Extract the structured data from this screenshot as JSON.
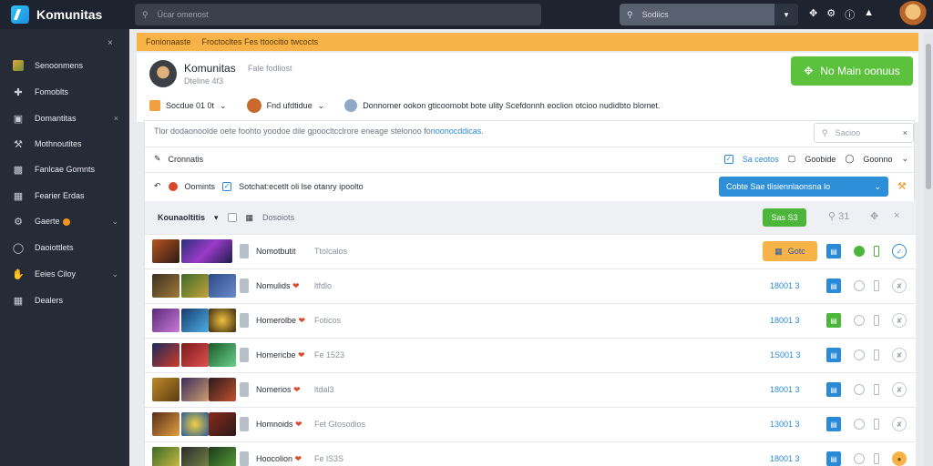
{
  "app": {
    "title": "Komunitas"
  },
  "topbar": {
    "search_placeholder": "Ücar omenost",
    "search2_value": "Sodiics",
    "search2_dropdown": "▾",
    "icons": [
      "puzzle-icon",
      "gear-icon",
      "info-icon",
      "bell-icon"
    ]
  },
  "sidebar": {
    "close": "×",
    "items": [
      {
        "label": "Senoonmens",
        "icon": "image-icon",
        "arrow": ""
      },
      {
        "label": "Fomoblts",
        "icon": "pin-icon",
        "arrow": ""
      },
      {
        "label": "Domantitas",
        "icon": "monitor-icon",
        "arrow": "×"
      },
      {
        "label": "Mothnoutites",
        "icon": "wrench-icon",
        "arrow": ""
      },
      {
        "label": "Fanlcae Gomnts",
        "icon": "screen-icon",
        "arrow": ""
      },
      {
        "label": "Fearier Erdas",
        "icon": "building-icon",
        "arrow": ""
      },
      {
        "label": "Gaerte",
        "icon": "gear-icon",
        "arrow": "⌄",
        "badge": true
      },
      {
        "label": "Daoiottlets",
        "icon": "circle-icon",
        "arrow": ""
      },
      {
        "label": "Eeies Ciloy",
        "icon": "thumb-icon",
        "arrow": "⌄"
      },
      {
        "label": "Dealers",
        "icon": "grid-icon",
        "arrow": ""
      }
    ]
  },
  "alert": {
    "left": "Fonionaaste",
    "text": "Froctocltes Fes  ttoocitio twcocts"
  },
  "profile": {
    "name": "Komunitas",
    "sub": "Fale fodliost",
    "role": "Dteline 4f3",
    "action_button": "No Main oonuus",
    "meta": [
      {
        "label": "Socdue 01 0t",
        "chevron": "⌄"
      },
      {
        "label": "Fnd ufdtidue",
        "chevron": "⌄"
      },
      {
        "label": "Donnomer ookon gticoomobt bote ulity Scefdonnh eoclion otcioo nudidbto blomet."
      }
    ]
  },
  "panel": {
    "notice_text": "Tlor dodaonoolde oete foohto yoodoe dile gpoocltcclrore eneage stelonoo fo",
    "notice_link": "noonocddicas.",
    "search_placeholder": "Sacioo",
    "row1": {
      "label": "Cronnatis",
      "opt1": "Sa ceotos",
      "opt2": "Goobide",
      "opt3": "Goonno",
      "chevron": "⌄"
    },
    "row2": {
      "label": "Oomints",
      "check_label": "Sotchat:ecetlt oli lse otanry ipoolto",
      "button": "Cobte Sae tlisiennlaonsna lo",
      "chevron": "⌄"
    },
    "thead": {
      "label": "Kounaoltitis",
      "chevron": "▾",
      "col2": "Dosoiots",
      "green_btn": "Sas S3",
      "icons": [
        "lock-count-icon",
        "puzzle-icon",
        "close-icon"
      ],
      "count": "31"
    }
  },
  "rows": [
    {
      "name": "Nomotbutit",
      "heart": false,
      "tag": "Ttolcalos",
      "num": "",
      "pill": "Gotc",
      "doc": "blue",
      "s1": "ok",
      "s2": "ok",
      "s3": "blue"
    },
    {
      "name": "Nomulids",
      "heart": true,
      "tag": "ltfdlo",
      "num": "18001 3",
      "pill": "",
      "doc": "blue",
      "s1": "",
      "s2": "",
      "s3": ""
    },
    {
      "name": "Homerolbe",
      "heart": true,
      "tag": "Foticos",
      "num": "18001 3",
      "pill": "",
      "doc": "green",
      "s1": "",
      "s2": "",
      "s3": ""
    },
    {
      "name": "Homericbe",
      "heart": true,
      "tag": "Fe 1523",
      "num": "1S001 3",
      "pill": "",
      "doc": "blue",
      "s1": "",
      "s2": "",
      "s3": ""
    },
    {
      "name": "Nomerios",
      "heart": true,
      "tag": "ltdal3",
      "num": "18001 3",
      "pill": "",
      "doc": "blue",
      "s1": "",
      "s2": "",
      "s3": ""
    },
    {
      "name": "Homnoids",
      "heart": true,
      "tag": "Fet Gtosodios",
      "num": "13001 3",
      "pill": "",
      "doc": "blue",
      "s1": "",
      "s2": "",
      "s3": ""
    },
    {
      "name": "Hoocolion",
      "heart": true,
      "tag": "Fe lS3S",
      "num": "18001 3",
      "pill": "",
      "doc": "blue",
      "s1": "",
      "s2": "",
      "s3": "orange"
    }
  ],
  "colors": {
    "accent_blue": "#2e8fd9",
    "green": "#5cc23e",
    "orange": "#f7b347",
    "sidebar_bg": "#262c37",
    "topbar_bg": "#1d2430"
  }
}
